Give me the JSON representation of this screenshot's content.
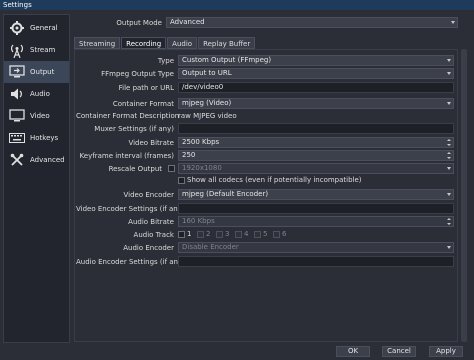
{
  "window": {
    "title": "Settings"
  },
  "sidebar": {
    "items": [
      {
        "label": "General",
        "icon": "gear-icon"
      },
      {
        "label": "Stream",
        "icon": "broadcast-icon"
      },
      {
        "label": "Output",
        "icon": "monitor-output-icon"
      },
      {
        "label": "Audio",
        "icon": "speaker-icon"
      },
      {
        "label": "Video",
        "icon": "display-icon"
      },
      {
        "label": "Hotkeys",
        "icon": "keyboard-icon"
      },
      {
        "label": "Advanced",
        "icon": "tools-icon"
      }
    ],
    "active": "Output"
  },
  "output_mode": {
    "label": "Output Mode",
    "value": "Advanced"
  },
  "tabs": [
    {
      "label": "Streaming"
    },
    {
      "label": "Recording"
    },
    {
      "label": "Audio"
    },
    {
      "label": "Replay Buffer"
    }
  ],
  "recording": {
    "type": {
      "label": "Type",
      "value": "Custom Output (FFmpeg)"
    },
    "ffmpeg_output_type": {
      "label": "FFmpeg Output Type",
      "value": "Output to URL"
    },
    "file_path": {
      "label": "File path or URL",
      "value": "/dev/video0"
    },
    "container_format": {
      "label": "Container Format",
      "value": "mjpeg (Video)"
    },
    "container_format_desc": {
      "label": "Container Format Description",
      "value": "raw MJPEG video"
    },
    "muxer_settings": {
      "label": "Muxer Settings (if any)",
      "value": ""
    },
    "video_bitrate": {
      "label": "Video Bitrate",
      "value": "2500 Kbps"
    },
    "keyframe_interval": {
      "label": "Keyframe interval (frames)",
      "value": "250"
    },
    "rescale_output": {
      "label": "Rescale Output",
      "value": "1920x1080"
    },
    "show_all_codecs": {
      "label": "Show all codecs (even if potentially incompatible)"
    },
    "video_encoder": {
      "label": "Video Encoder",
      "value": "mjpeg (Default Encoder)"
    },
    "video_encoder_settings": {
      "label": "Video Encoder Settings (if any)",
      "value": ""
    },
    "audio_bitrate": {
      "label": "Audio Bitrate",
      "value": "160 Kbps"
    },
    "audio_track": {
      "label": "Audio Track",
      "tracks": [
        "1",
        "2",
        "3",
        "4",
        "5",
        "6"
      ]
    },
    "audio_encoder": {
      "label": "Audio Encoder",
      "value": "Disable Encoder"
    },
    "audio_encoder_settings": {
      "label": "Audio Encoder Settings (if any)",
      "value": ""
    }
  },
  "buttons": {
    "ok": "OK",
    "cancel": "Cancel",
    "apply": "Apply"
  }
}
